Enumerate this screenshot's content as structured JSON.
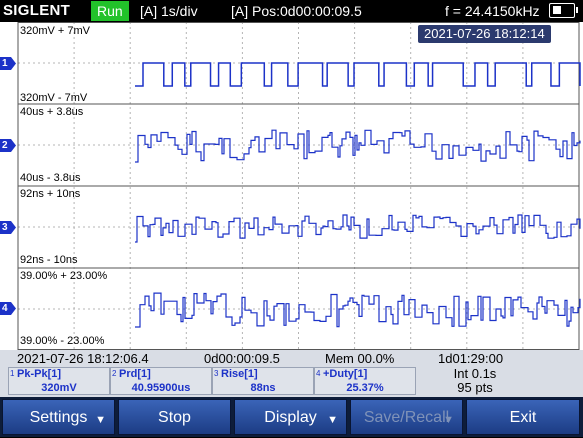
{
  "header": {
    "brand": "SIGLENT",
    "run_state": "Run",
    "timebase": "[A] 1s/div",
    "position": "[A] Pos:0d00:00:09.5",
    "frequency": "f = 24.4150kHz",
    "battery_icon": "battery-icon"
  },
  "display": {
    "timestamp": "2021-07-26 18:12:14",
    "channels": [
      {
        "id": "1",
        "upper": "320mV + 7mV",
        "lower": "320mV - 7mV"
      },
      {
        "id": "2",
        "upper": "40us + 3.8us",
        "lower": "40us - 3.8us"
      },
      {
        "id": "3",
        "upper": "92ns + 10ns",
        "lower": "92ns - 10ns"
      },
      {
        "id": "4",
        "upper": "39.00% + 23.00%",
        "lower": "39.00% - 23.00%"
      }
    ],
    "trace_color": "#1c32c8",
    "grid_color": "#b4b4b4"
  },
  "status": {
    "date": "2021-07-26 18:12:06.4",
    "elapsed": "0d00:00:09.5",
    "memory": "Mem 00.0%",
    "duration": "1d01:29:00",
    "interval": "Int 0.1s",
    "points": "95 pts"
  },
  "measurements": [
    {
      "num": "1",
      "label": "Pk-Pk[1]",
      "value": "320mV"
    },
    {
      "num": "2",
      "label": "Prd[1]",
      "value": "40.95900us"
    },
    {
      "num": "3",
      "label": "Rise[1]",
      "value": "88ns"
    },
    {
      "num": "4",
      "label": "+Duty[1]",
      "value": "25.37%"
    }
  ],
  "buttons": {
    "settings": "Settings",
    "stop": "Stop",
    "display": "Display",
    "save_recall": "Save/Recall",
    "exit": "Exit"
  }
}
